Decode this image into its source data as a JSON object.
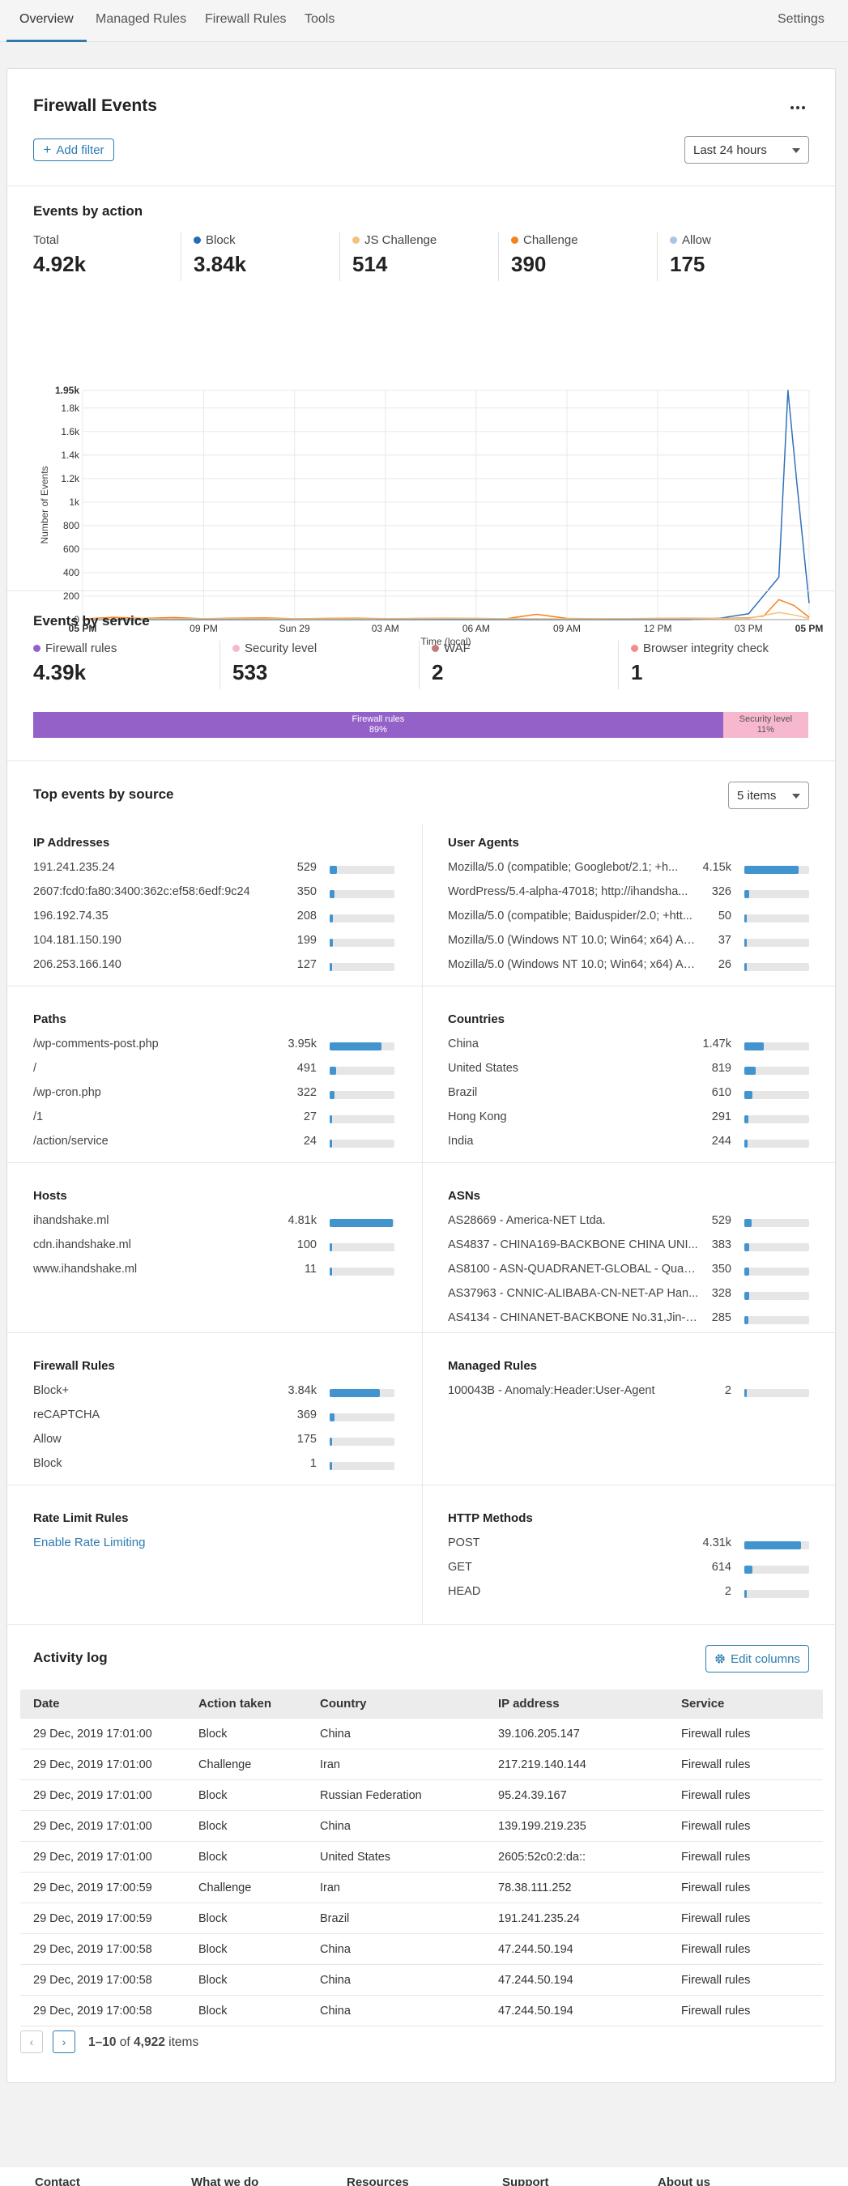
{
  "nav": {
    "tabs": [
      {
        "label": "Overview",
        "active": true
      },
      {
        "label": "Managed Rules",
        "active": false
      },
      {
        "label": "Firewall Rules",
        "active": false
      },
      {
        "label": "Tools",
        "active": false
      }
    ],
    "settings": "Settings"
  },
  "header": {
    "title": "Firewall Events",
    "more_icon": "ellipsis-icon",
    "add_filter": "Add filter",
    "timerange": "Last 24 hours"
  },
  "events_by_action": {
    "title": "Events by action",
    "stats": [
      {
        "label": "Total",
        "value": "4.92k",
        "color": ""
      },
      {
        "label": "Block",
        "value": "3.84k",
        "color": "#1f6fb2"
      },
      {
        "label": "JS Challenge",
        "value": "514",
        "color": "#f7c07a"
      },
      {
        "label": "Challenge",
        "value": "390",
        "color": "#f6821f"
      },
      {
        "label": "Allow",
        "value": "175",
        "color": "#a9c4e4"
      }
    ]
  },
  "chart_data": {
    "type": "line",
    "ylabel": "Number of Events",
    "xlabel": "Time (local)",
    "ylim": [
      0,
      1950
    ],
    "y_ticks": [
      "0",
      "200",
      "400",
      "600",
      "800",
      "1k",
      "1.2k",
      "1.4k",
      "1.6k",
      "1.8k",
      "1.95k"
    ],
    "x_ticks": [
      "05 PM",
      "09 PM",
      "Sun 29",
      "03 AM",
      "06 AM",
      "09 AM",
      "12 PM",
      "03 PM",
      "05 PM"
    ],
    "grid": true,
    "series": [
      {
        "name": "Block",
        "color": "#2f72b8",
        "x": [
          0,
          20,
          21,
          22,
          23,
          23.3,
          23.6,
          24
        ],
        "values": [
          0,
          0,
          10,
          50,
          360,
          1950,
          1150,
          140
        ]
      },
      {
        "name": "Challenge",
        "color": "#f6821f",
        "x": [
          0,
          1,
          2,
          3,
          4,
          5,
          6,
          7,
          8,
          9,
          10,
          11,
          12,
          13,
          14,
          15,
          16,
          17,
          18,
          19,
          20,
          21,
          22,
          22.5,
          23,
          23.5,
          24
        ],
        "values": [
          5,
          20,
          10,
          18,
          8,
          12,
          15,
          8,
          10,
          12,
          9,
          10,
          11,
          10,
          8,
          45,
          10,
          8,
          9,
          10,
          11,
          10,
          15,
          30,
          170,
          120,
          20
        ]
      },
      {
        "name": "JS Challenge",
        "color": "#f7c07a",
        "x": [
          0,
          4,
          8,
          12,
          16,
          20,
          22,
          23,
          23.5,
          24
        ],
        "values": [
          5,
          8,
          6,
          9,
          7,
          8,
          10,
          60,
          40,
          10
        ]
      }
    ]
  },
  "events_by_service": {
    "title": "Events by service",
    "stats": [
      {
        "label": "Firewall rules",
        "value": "4.39k",
        "color": "#9461c9"
      },
      {
        "label": "Security level",
        "value": "533",
        "color": "#f7b8cf"
      },
      {
        "label": "WAF",
        "value": "2",
        "color": "#c47a7a"
      },
      {
        "label": "Browser integrity check",
        "value": "1",
        "color": "#f28b8b"
      }
    ],
    "bar": [
      {
        "label": "Firewall rules",
        "pct_label": "89%",
        "pct": 89,
        "color": "#9461c9",
        "text_color": "#ffffff"
      },
      {
        "label": "Security level",
        "pct_label": "11%",
        "pct": 11,
        "color": "#f7b8cf",
        "text_color": "#555555"
      }
    ]
  },
  "top_events": {
    "title": "Top events by source",
    "items_select": "5 items",
    "panels": [
      {
        "title": "IP Addresses",
        "rows": [
          {
            "label": "191.241.235.24",
            "value": "529",
            "fraction": 0.11
          },
          {
            "label": "2607:fcd0:fa80:3400:362c:ef58:6edf:9c24",
            "value": "350",
            "fraction": 0.07
          },
          {
            "label": "196.192.74.35",
            "value": "208",
            "fraction": 0.05
          },
          {
            "label": "104.181.150.190",
            "value": "199",
            "fraction": 0.05
          },
          {
            "label": "206.253.166.140",
            "value": "127",
            "fraction": 0.03
          }
        ]
      },
      {
        "title": "User Agents",
        "rows": [
          {
            "label": "Mozilla/5.0 (compatible; Googlebot/2.1; +h...",
            "value": "4.15k",
            "fraction": 0.84
          },
          {
            "label": "WordPress/5.4-alpha-47018; http://ihandsha...",
            "value": "326",
            "fraction": 0.07
          },
          {
            "label": "Mozilla/5.0 (compatible; Baiduspider/2.0; +htt...",
            "value": "50",
            "fraction": 0.01
          },
          {
            "label": "Mozilla/5.0 (Windows NT 10.0; Win64; x64) Ap...",
            "value": "37",
            "fraction": 0.01
          },
          {
            "label": "Mozilla/5.0 (Windows NT 10.0; Win64; x64) Ap...",
            "value": "26",
            "fraction": 0.01
          }
        ]
      },
      {
        "title": "Paths",
        "rows": [
          {
            "label": "/wp-comments-post.php",
            "value": "3.95k",
            "fraction": 0.8
          },
          {
            "label": "/",
            "value": "491",
            "fraction": 0.1
          },
          {
            "label": "/wp-cron.php",
            "value": "322",
            "fraction": 0.07
          },
          {
            "label": "/1",
            "value": "27",
            "fraction": 0.01
          },
          {
            "label": "/action/service",
            "value": "24",
            "fraction": 0.01
          }
        ]
      },
      {
        "title": "Countries",
        "rows": [
          {
            "label": "China",
            "value": "1.47k",
            "fraction": 0.3
          },
          {
            "label": "United States",
            "value": "819",
            "fraction": 0.17
          },
          {
            "label": "Brazil",
            "value": "610",
            "fraction": 0.12
          },
          {
            "label": "Hong Kong",
            "value": "291",
            "fraction": 0.06
          },
          {
            "label": "India",
            "value": "244",
            "fraction": 0.05
          }
        ]
      },
      {
        "title": "Hosts",
        "rows": [
          {
            "label": "ihandshake.ml",
            "value": "4.81k",
            "fraction": 0.98
          },
          {
            "label": "cdn.ihandshake.ml",
            "value": "100",
            "fraction": 0.02
          },
          {
            "label": "www.ihandshake.ml",
            "value": "11",
            "fraction": 0.0
          }
        ]
      },
      {
        "title": "ASNs",
        "rows": [
          {
            "label": "AS28669 - America-NET Ltda.",
            "value": "529",
            "fraction": 0.11
          },
          {
            "label": "AS4837 - CHINA169-BACKBONE CHINA UNI...",
            "value": "383",
            "fraction": 0.08
          },
          {
            "label": "AS8100 - ASN-QUADRANET-GLOBAL - Quad...",
            "value": "350",
            "fraction": 0.07
          },
          {
            "label": "AS37963 - CNNIC-ALIBABA-CN-NET-AP Han...",
            "value": "328",
            "fraction": 0.07
          },
          {
            "label": "AS4134 - CHINANET-BACKBONE No.31,Jin-ro...",
            "value": "285",
            "fraction": 0.06
          }
        ]
      },
      {
        "title": "Firewall Rules",
        "rows": [
          {
            "label": "Block+",
            "value": "3.84k",
            "fraction": 0.78
          },
          {
            "label": "reCAPTCHA",
            "value": "369",
            "fraction": 0.08
          },
          {
            "label": "Allow",
            "value": "175",
            "fraction": 0.04
          },
          {
            "label": "Block",
            "value": "1",
            "fraction": 0.0
          }
        ]
      },
      {
        "title": "Managed Rules",
        "rows": [
          {
            "label": "100043B - Anomaly:Header:User-Agent",
            "value": "2",
            "fraction": 0.0
          }
        ]
      },
      {
        "title": "Rate Limit Rules",
        "link": "Enable Rate Limiting",
        "rows": []
      },
      {
        "title": "HTTP Methods",
        "rows": [
          {
            "label": "POST",
            "value": "4.31k",
            "fraction": 0.88
          },
          {
            "label": "GET",
            "value": "614",
            "fraction": 0.12
          },
          {
            "label": "HEAD",
            "value": "2",
            "fraction": 0.0
          }
        ]
      }
    ]
  },
  "activity_log": {
    "title": "Activity log",
    "edit_columns": "Edit columns",
    "columns": [
      "Date",
      "Action taken",
      "Country",
      "IP address",
      "Service"
    ],
    "rows": [
      [
        "29 Dec, 2019 17:01:00",
        "Block",
        "China",
        "39.106.205.147",
        "Firewall rules"
      ],
      [
        "29 Dec, 2019 17:01:00",
        "Challenge",
        "Iran",
        "217.219.140.144",
        "Firewall rules"
      ],
      [
        "29 Dec, 2019 17:01:00",
        "Block",
        "Russian Federation",
        "95.24.39.167",
        "Firewall rules"
      ],
      [
        "29 Dec, 2019 17:01:00",
        "Block",
        "China",
        "139.199.219.235",
        "Firewall rules"
      ],
      [
        "29 Dec, 2019 17:01:00",
        "Block",
        "United States",
        "2605:52c0:2:da::",
        "Firewall rules"
      ],
      [
        "29 Dec, 2019 17:00:59",
        "Challenge",
        "Iran",
        "78.38.111.252",
        "Firewall rules"
      ],
      [
        "29 Dec, 2019 17:00:59",
        "Block",
        "Brazil",
        "191.241.235.24",
        "Firewall rules"
      ],
      [
        "29 Dec, 2019 17:00:58",
        "Block",
        "China",
        "47.244.50.194",
        "Firewall rules"
      ],
      [
        "29 Dec, 2019 17:00:58",
        "Block",
        "China",
        "47.244.50.194",
        "Firewall rules"
      ],
      [
        "29 Dec, 2019 17:00:58",
        "Block",
        "China",
        "47.244.50.194",
        "Firewall rules"
      ]
    ],
    "pagination": {
      "range": "1–10",
      "of": "of",
      "total": "4,922",
      "items": "items"
    }
  },
  "footer": {
    "columns": [
      "Contact",
      "What we do",
      "Resources",
      "Support",
      "About us"
    ]
  }
}
